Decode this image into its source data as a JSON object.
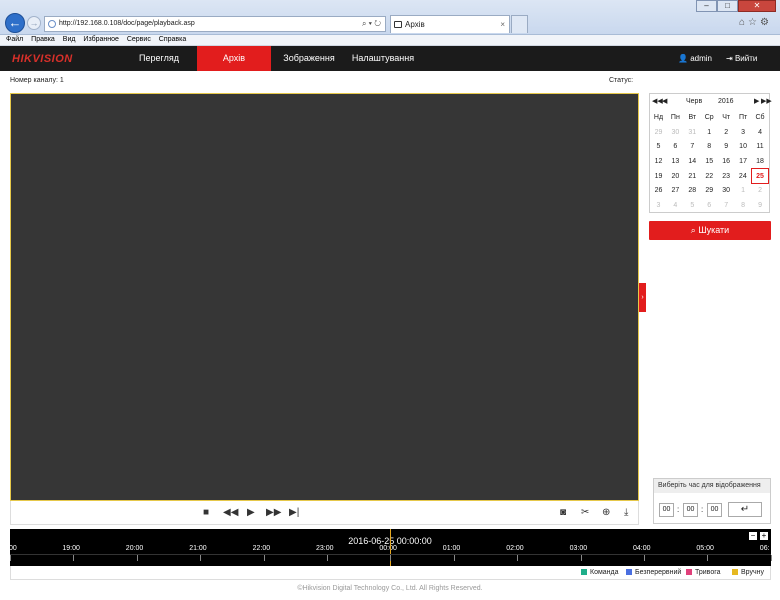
{
  "browser": {
    "url": "http://192.168.0.108/doc/page/playback.asp",
    "tab_title": "Архів",
    "menu": [
      "Файл",
      "Правка",
      "Вид",
      "Избранное",
      "Сервис",
      "Справка"
    ]
  },
  "app": {
    "logo": "HIKVISION",
    "nav": {
      "preview": "Перегляд",
      "archive": "Архів",
      "image": "Зображення",
      "settings": "Налаштування"
    },
    "user": "admin",
    "logout": "Вийти",
    "channel_label": "Номер каналу: 1",
    "status_label": "Статус:",
    "accent": "#e21d1d"
  },
  "calendar": {
    "month": "Черв",
    "year": "2016",
    "weekdays": [
      "Нд",
      "Пн",
      "Вт",
      "Ср",
      "Чт",
      "Пт",
      "Сб"
    ],
    "rows": [
      [
        "29",
        "30",
        "31",
        "1",
        "2",
        "3",
        "4"
      ],
      [
        "5",
        "6",
        "7",
        "8",
        "9",
        "10",
        "11"
      ],
      [
        "12",
        "13",
        "14",
        "15",
        "16",
        "17",
        "18"
      ],
      [
        "19",
        "20",
        "21",
        "22",
        "23",
        "24",
        "25"
      ],
      [
        "26",
        "27",
        "28",
        "29",
        "30",
        "1",
        "2"
      ],
      [
        "3",
        "4",
        "5",
        "6",
        "7",
        "8",
        "9"
      ]
    ],
    "selected": "25",
    "search_label": "Шукати"
  },
  "time_picker": {
    "title": "Виберіть час для відображення",
    "hh": "00",
    "mm": "00",
    "ss": "00"
  },
  "timeline": {
    "datetime": "2016-06-25 00:00:00",
    "ticks": [
      ":00",
      "19:00",
      "20:00",
      "21:00",
      "22:00",
      "23:00",
      "00:00",
      "01:00",
      "02:00",
      "03:00",
      "04:00",
      "05:00",
      "06:"
    ]
  },
  "legend": [
    {
      "label": "Команда",
      "color": "#1fae8a"
    },
    {
      "label": "Безперервний",
      "color": "#4a6fe0"
    },
    {
      "label": "Тривога",
      "color": "#e0407a"
    },
    {
      "label": "Вручну",
      "color": "#e6b820"
    }
  ],
  "footer": "©Hikvision Digital Technology Co., Ltd. All Rights Reserved."
}
